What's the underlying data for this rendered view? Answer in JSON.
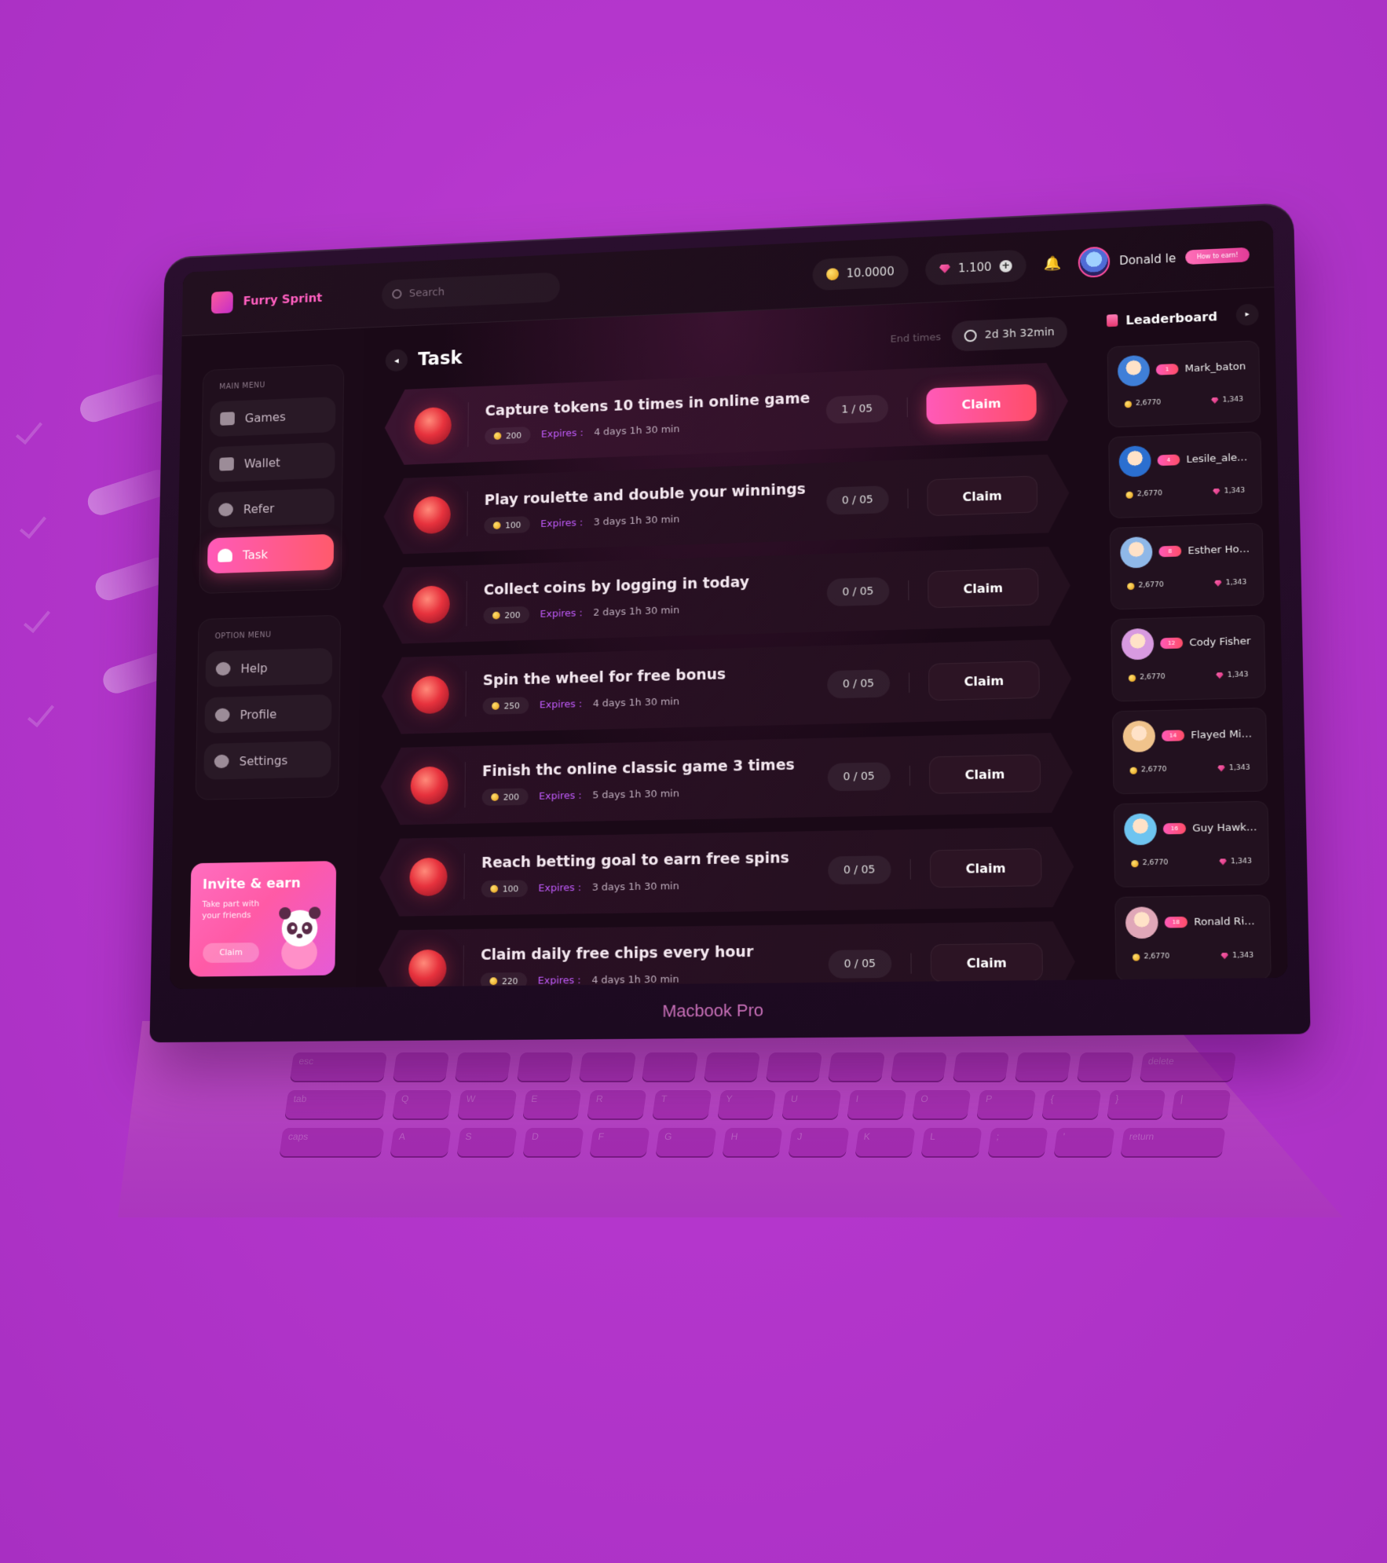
{
  "app": {
    "name": "Furry Sprint"
  },
  "topbar": {
    "search_placeholder": "Search",
    "coins": "10.0000",
    "gems": "1.100",
    "plus": "+",
    "user_name": "Donald le",
    "how_to_earn": "How to earn!"
  },
  "sidebar": {
    "main_caption": "MAIN MENU",
    "main_items": [
      {
        "label": "Games",
        "icon": "gamepad-icon"
      },
      {
        "label": "Wallet",
        "icon": "wallet-icon"
      },
      {
        "label": "Refer",
        "icon": "refer-icon"
      },
      {
        "label": "Task",
        "icon": "task-icon",
        "active": true
      }
    ],
    "option_caption": "OPTION MENU",
    "option_items": [
      {
        "label": "Help",
        "icon": "help-icon"
      },
      {
        "label": "Profile",
        "icon": "profile-icon"
      },
      {
        "label": "Settings",
        "icon": "gear-icon"
      }
    ],
    "invite": {
      "title": "Invite & earn",
      "subtitle": "Take part with your friends",
      "button": "Claim"
    }
  },
  "main": {
    "back": "◂",
    "title": "Task",
    "end_times_label": "End times",
    "end_times_value": "2d 3h 32min",
    "expires_label": "Expires :",
    "tasks": [
      {
        "title": "Capture tokens 10 times in online game",
        "reward": "200",
        "expires": "4 days 1h 30 min",
        "progress": "1 / 05",
        "claim": "Claim",
        "active": true
      },
      {
        "title": "Play roulette and double your winnings",
        "reward": "100",
        "expires": "3 days 1h 30 min",
        "progress": "0 / 05",
        "claim": "Claim"
      },
      {
        "title": "Collect coins by logging in today",
        "reward": "200",
        "expires": "2 days 1h 30 min",
        "progress": "0 / 05",
        "claim": "Claim"
      },
      {
        "title": "Spin the wheel for free bonus",
        "reward": "250",
        "expires": "4 days 1h 30 min",
        "progress": "0 / 05",
        "claim": "Claim"
      },
      {
        "title": "Finish thc online classic game 3 times",
        "reward": "200",
        "expires": "5 days 1h 30 min",
        "progress": "0 / 05",
        "claim": "Claim"
      },
      {
        "title": "Reach betting goal to earn free spins",
        "reward": "100",
        "expires": "3 days 1h 30 min",
        "progress": "0 / 05",
        "claim": "Claim"
      },
      {
        "title": "Claim daily free chips every hour",
        "reward": "220",
        "expires": "4 days 1h 30 min",
        "progress": "0 / 05",
        "claim": "Claim"
      }
    ]
  },
  "leaderboard": {
    "title": "Leaderboard",
    "next": "▸",
    "players": [
      {
        "name": "Mark_baton",
        "rank": "1",
        "coins": "2,6770",
        "gems": "1,343",
        "color": "#3f7fd8"
      },
      {
        "name": "Lesile_alexnd...",
        "rank": "4",
        "coins": "2,6770",
        "gems": "1,343",
        "color": "#2b6fd0"
      },
      {
        "name": "Esther Howard",
        "rank": "8",
        "coins": "2,6770",
        "gems": "1,343",
        "color": "#8fb8e8"
      },
      {
        "name": "Cody Fisher",
        "rank": "12",
        "coins": "2,6770",
        "gems": "1,343",
        "color": "#d89ae0"
      },
      {
        "name": "Flayed Mines",
        "rank": "14",
        "coins": "2,6770",
        "gems": "1,343",
        "color": "#f0c38c"
      },
      {
        "name": "Guy Hawkins",
        "rank": "16",
        "coins": "2,6770",
        "gems": "1,343",
        "color": "#6ec4f0"
      },
      {
        "name": "Ronald Richar...",
        "rank": "18",
        "coins": "2,6770",
        "gems": "1,343",
        "color": "#e0a7b8"
      }
    ]
  },
  "device": {
    "label": "Macbook Pro"
  },
  "keyboard": {
    "rows": [
      [
        "esc",
        "",
        "",
        "",
        "",
        "",
        "",
        "",
        "",
        "",
        "",
        "",
        "",
        "delete"
      ],
      [
        "tab",
        "Q",
        "W",
        "E",
        "R",
        "T",
        "Y",
        "U",
        "I",
        "O",
        "P",
        "{",
        "}",
        "|"
      ],
      [
        "caps",
        "A",
        "S",
        "D",
        "F",
        "G",
        "H",
        "J",
        "K",
        "L",
        ";",
        "'",
        "return"
      ]
    ]
  }
}
